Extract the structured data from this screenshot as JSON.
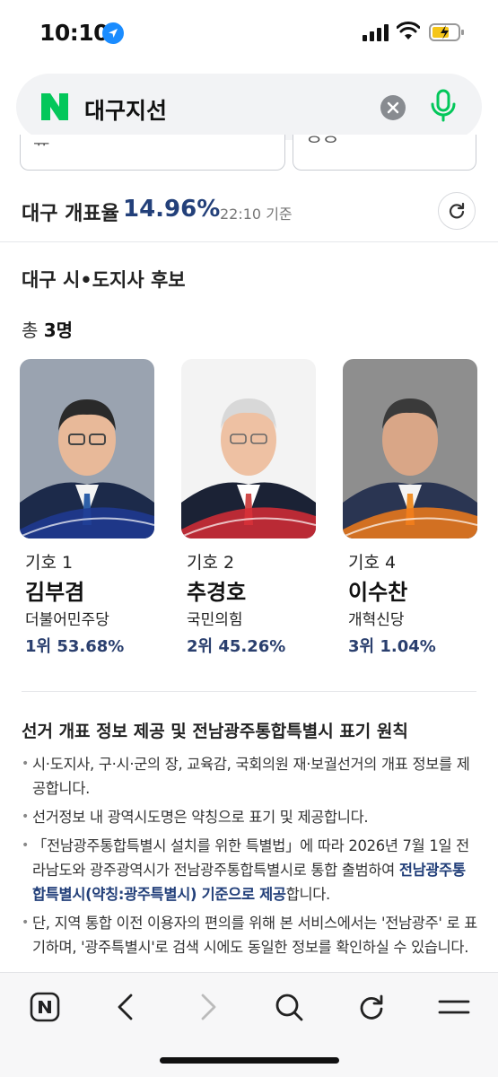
{
  "status": {
    "time": "10:10"
  },
  "search": {
    "query": "대구지선"
  },
  "turnout": {
    "label": "대구 개표율",
    "value": "14.96%",
    "time": "22:10 기준"
  },
  "section": {
    "title": "대구 시•도지사 후보",
    "count_prefix": "총 ",
    "count": "3명"
  },
  "candidates": [
    {
      "symbol": "기호 1",
      "name": "김부겸",
      "party": "더불어민주당",
      "rank": "1위",
      "percent": "53.68%",
      "accent": "#1f3a93"
    },
    {
      "symbol": "기호 2",
      "name": "추경호",
      "party": "국민의힘",
      "rank": "2위",
      "percent": "45.26%",
      "accent": "#d62b35"
    },
    {
      "symbol": "기호 4",
      "name": "이수찬",
      "party": "개혁신당",
      "rank": "3위",
      "percent": "1.04%",
      "accent": "#f07a1a"
    }
  ],
  "notice": {
    "title": "선거 개표 정보 제공 및 전남광주통합특별시 표기 원칙",
    "items": [
      "시·도지사, 구·시·군의 장, 교육감, 국회의원 재·보궐선거의 개표 정보를 제공합니다.",
      "선거정보 내 광역시도명은 약칭으로 표기 및 제공합니다.",
      {
        "before": "「전남광주통합특별시 설치를 위한 특별법」에 따라 2026년 7월 1일 전라남도와 광주광역시가 전남광주통합특별시로 통합 출범하여 ",
        "highlight": "전남광주통합특별시(약칭:광주특별시) 기준으로 제공",
        "after": "합니다."
      },
      "단, 지역 통합 이전 이용자의 편의를 위해 본 서비스에서는 '전남광주' 로 표기하며, '광주특별시'로 검색 시에도 동일한 정보를 확인하실 수 있습니다."
    ]
  },
  "icons": {
    "naver_logo": "naver-n-logo",
    "clear": "close-circle-icon",
    "mic": "microphone-icon",
    "refresh": "refresh-icon",
    "toolbar": [
      "naver-home-icon",
      "back-icon",
      "forward-icon",
      "search-icon",
      "reload-icon",
      "menu-icon"
    ]
  },
  "colors": {
    "accent_navy": "#23407a",
    "naver_green": "#03c75a"
  }
}
